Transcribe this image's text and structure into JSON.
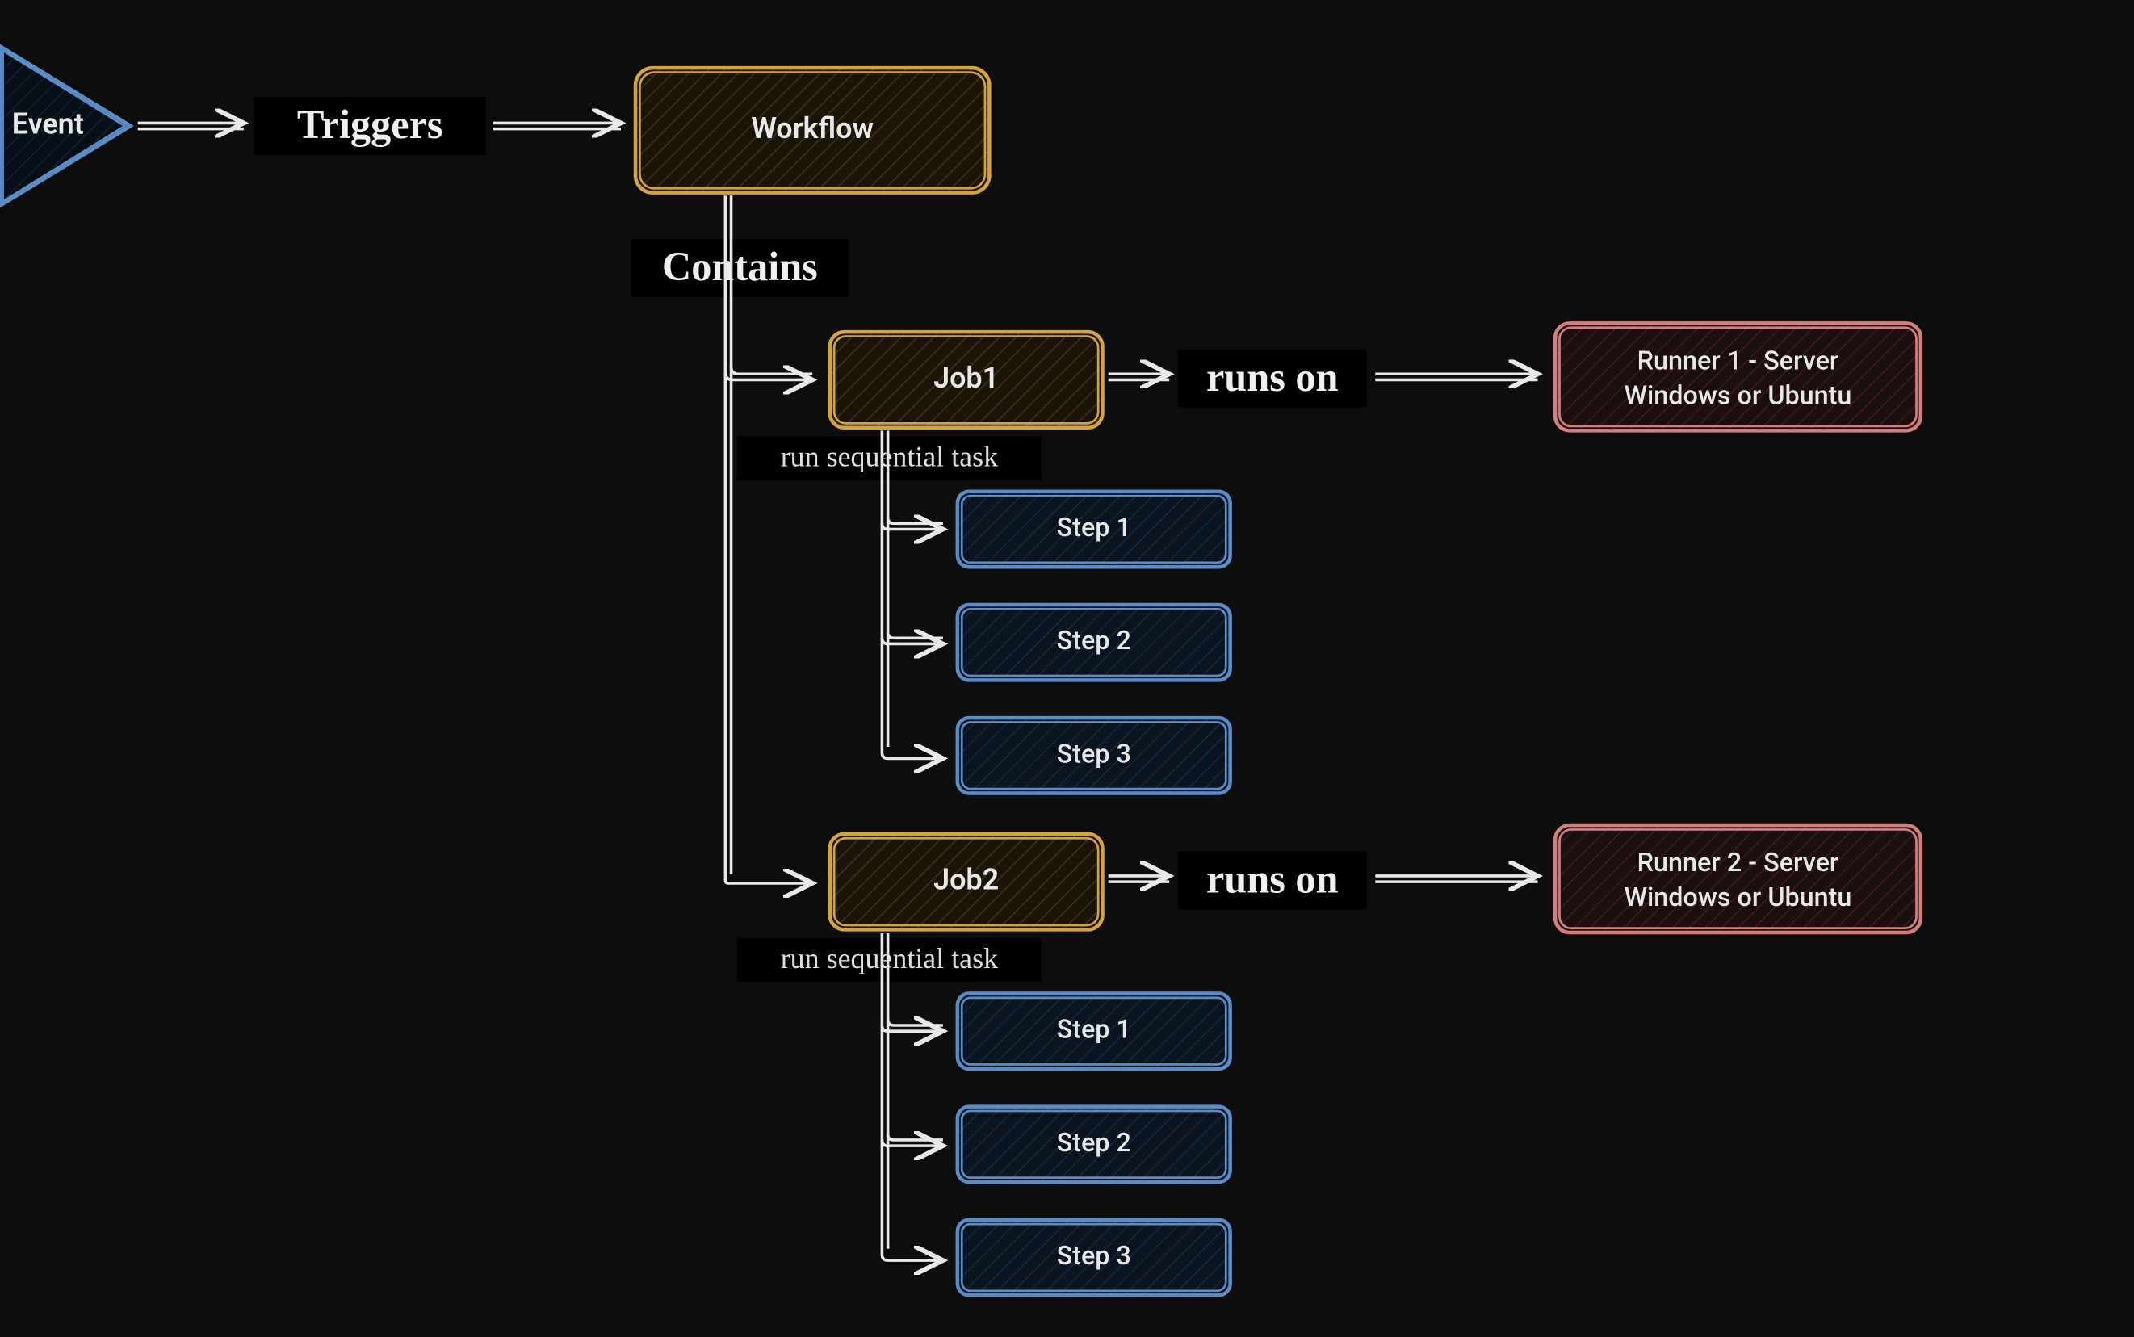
{
  "event": {
    "label": "Event"
  },
  "edges": {
    "triggers": "Triggers",
    "contains": "Contains",
    "runs_on": "runs on",
    "run_sequential_task": "run sequential task"
  },
  "workflow": {
    "label": "Workflow"
  },
  "jobs": [
    {
      "label": "Job1",
      "runner": {
        "line1": "Runner 1 - Server",
        "line2": "Windows or Ubuntu"
      },
      "steps": [
        "Step 1",
        "Step 2",
        "Step 3"
      ]
    },
    {
      "label": "Job2",
      "runner": {
        "line1": "Runner 2 - Server",
        "line2": "Windows or Ubuntu"
      },
      "steps": [
        "Step 1",
        "Step 2",
        "Step 3"
      ]
    }
  ],
  "colors": {
    "background": "#0d0d0d",
    "orange": "#d4a43c",
    "blue": "#5a8cc7",
    "red": "#d47f7f",
    "text": "#e8e8e8"
  }
}
